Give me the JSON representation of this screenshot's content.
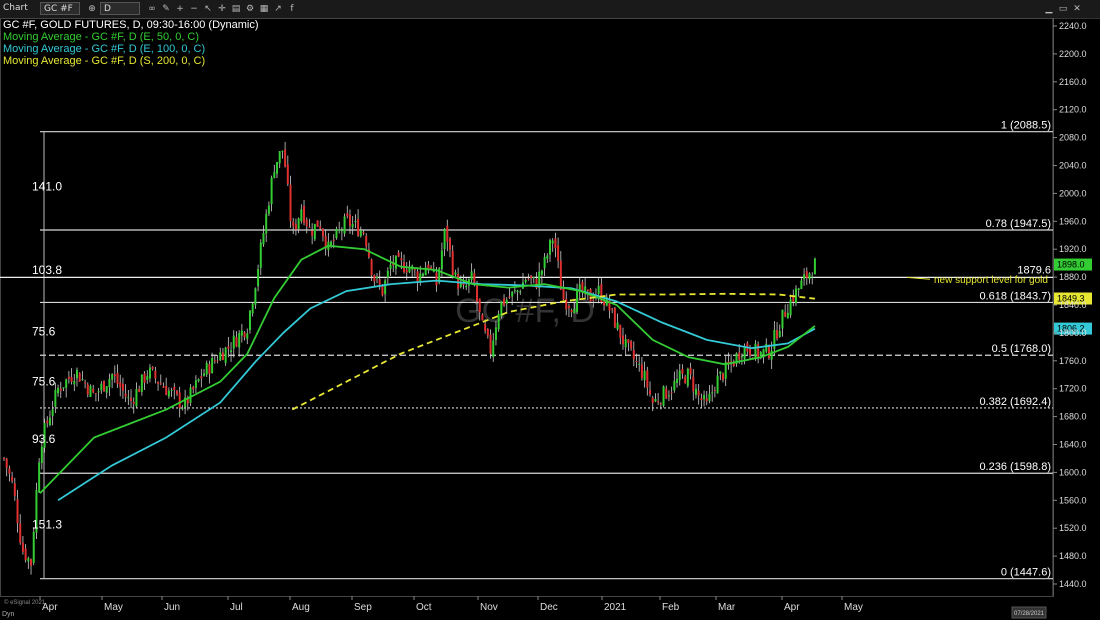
{
  "toolbar": {
    "window_label": "Chart",
    "symbol_field": "GC #F",
    "interval_field": "D"
  },
  "legend": {
    "title": "GC #F, GOLD FUTURES, D, 09:30-16:00 (Dynamic)",
    "ma50": "Moving Average - GC #F, D (E, 50, 0, C)",
    "ma100": "Moving Average - GC #F, D (E, 100, 0, C)",
    "ma200": "Moving Average - GC #F, D (S, 200, 0, C)"
  },
  "watermark": "GC #F, D",
  "footer": {
    "copyright": "© eSignal 2021",
    "corner_label": "Dyn",
    "date_box": "07/28/2021"
  },
  "colors": {
    "background": "#000000",
    "candle_up": "#33cc33",
    "candle_down": "#e03030",
    "ma50": "#33cc33",
    "ma100": "#33c9d6",
    "ma200": "#e6e633",
    "fib_line": "#d8d8d8",
    "annotation": "#e6e633",
    "title": "#ffffff"
  },
  "chart_data": {
    "type": "candlestick",
    "instrument": "GC #F, GOLD FUTURES",
    "timeframe": "D",
    "ylim": [
      1430,
      2260
    ],
    "y_ticks": [
      1440.0,
      1480.0,
      1520.0,
      1560.0,
      1600.0,
      1640.0,
      1680.0,
      1720.0,
      1760.0,
      1800.0,
      1840.0,
      1880.0,
      1920.0,
      1960.0,
      2000.0,
      2040.0,
      2080.0,
      2120.0,
      2160.0,
      2200.0,
      2240.0
    ],
    "x_labels": [
      "Apr",
      "May",
      "Jun",
      "Jul",
      "Aug",
      "Sep",
      "Oct",
      "Nov",
      "Dec",
      "2021",
      "Feb",
      "Mar",
      "Apr",
      "May"
    ],
    "fib_levels": [
      {
        "label": "1 (2088.5)",
        "price": 2088.5,
        "style": "solid"
      },
      {
        "label": "0.78 (1947.5)",
        "price": 1947.5,
        "style": "solid"
      },
      {
        "label": "0.618 (1843.7)",
        "price": 1843.7,
        "style": "solid"
      },
      {
        "label": "0.5 (1768.0)",
        "price": 1768.0,
        "style": "dashed"
      },
      {
        "label": "0.382 (1692.4)",
        "price": 1692.4,
        "style": "dotted"
      },
      {
        "label": "0.236 (1598.8)",
        "price": 1598.8,
        "style": "solid"
      },
      {
        "label": "0 (1447.6)",
        "price": 1447.6,
        "style": "solid"
      }
    ],
    "support_line": {
      "price": 1879.6,
      "label": "1879.6"
    },
    "annotation": "new support level for gold",
    "price_flags": [
      {
        "label": "1898.0",
        "price": 1898.0,
        "color": "#33cc33"
      },
      {
        "label": "1849.3",
        "price": 1849.3,
        "color": "#e6e633"
      },
      {
        "label": "1806.2",
        "price": 1806.2,
        "color": "#33c9d6"
      }
    ],
    "range_labels": [
      {
        "label": "141.0",
        "price": 2010
      },
      {
        "label": "103.8",
        "price": 1890
      },
      {
        "label": "75.6",
        "price": 1802
      },
      {
        "label": "75.6",
        "price": 1730
      },
      {
        "label": "93.6",
        "price": 1648
      },
      {
        "label": "151.3",
        "price": 1525
      }
    ],
    "close_path": [
      {
        "t": 0.0,
        "p": 1620
      },
      {
        "t": 0.01,
        "p": 1580
      },
      {
        "t": 0.02,
        "p": 1490
      },
      {
        "t": 0.03,
        "p": 1470
      },
      {
        "t": 0.04,
        "p": 1640
      },
      {
        "t": 0.06,
        "p": 1720
      },
      {
        "t": 0.08,
        "p": 1745
      },
      {
        "t": 0.1,
        "p": 1710
      },
      {
        "t": 0.12,
        "p": 1740
      },
      {
        "t": 0.14,
        "p": 1700
      },
      {
        "t": 0.16,
        "p": 1745
      },
      {
        "t": 0.18,
        "p": 1720
      },
      {
        "t": 0.2,
        "p": 1695
      },
      {
        "t": 0.22,
        "p": 1740
      },
      {
        "t": 0.24,
        "p": 1770
      },
      {
        "t": 0.25,
        "p": 1780
      },
      {
        "t": 0.27,
        "p": 1810
      },
      {
        "t": 0.28,
        "p": 1880
      },
      {
        "t": 0.29,
        "p": 1960
      },
      {
        "t": 0.3,
        "p": 2040
      },
      {
        "t": 0.31,
        "p": 2065
      },
      {
        "t": 0.32,
        "p": 1940
      },
      {
        "t": 0.33,
        "p": 1980
      },
      {
        "t": 0.34,
        "p": 1945
      },
      {
        "t": 0.35,
        "p": 1960
      },
      {
        "t": 0.36,
        "p": 1920
      },
      {
        "t": 0.38,
        "p": 1960
      },
      {
        "t": 0.4,
        "p": 1945
      },
      {
        "t": 0.41,
        "p": 1880
      },
      {
        "t": 0.42,
        "p": 1860
      },
      {
        "t": 0.43,
        "p": 1900
      },
      {
        "t": 0.45,
        "p": 1895
      },
      {
        "t": 0.46,
        "p": 1880
      },
      {
        "t": 0.47,
        "p": 1900
      },
      {
        "t": 0.48,
        "p": 1870
      },
      {
        "t": 0.49,
        "p": 1950
      },
      {
        "t": 0.5,
        "p": 1880
      },
      {
        "t": 0.51,
        "p": 1860
      },
      {
        "t": 0.52,
        "p": 1880
      },
      {
        "t": 0.53,
        "p": 1810
      },
      {
        "t": 0.54,
        "p": 1775
      },
      {
        "t": 0.55,
        "p": 1840
      },
      {
        "t": 0.57,
        "p": 1860
      },
      {
        "t": 0.58,
        "p": 1880
      },
      {
        "t": 0.59,
        "p": 1870
      },
      {
        "t": 0.6,
        "p": 1900
      },
      {
        "t": 0.61,
        "p": 1940
      },
      {
        "t": 0.62,
        "p": 1850
      },
      {
        "t": 0.63,
        "p": 1840
      },
      {
        "t": 0.64,
        "p": 1860
      },
      {
        "t": 0.65,
        "p": 1850
      },
      {
        "t": 0.66,
        "p": 1860
      },
      {
        "t": 0.67,
        "p": 1840
      },
      {
        "t": 0.68,
        "p": 1810
      },
      {
        "t": 0.69,
        "p": 1780
      },
      {
        "t": 0.7,
        "p": 1760
      },
      {
        "t": 0.71,
        "p": 1740
      },
      {
        "t": 0.72,
        "p": 1700
      },
      {
        "t": 0.73,
        "p": 1710
      },
      {
        "t": 0.74,
        "p": 1720
      },
      {
        "t": 0.75,
        "p": 1735
      },
      {
        "t": 0.76,
        "p": 1740
      },
      {
        "t": 0.77,
        "p": 1710
      },
      {
        "t": 0.78,
        "p": 1695
      },
      {
        "t": 0.79,
        "p": 1730
      },
      {
        "t": 0.8,
        "p": 1745
      },
      {
        "t": 0.81,
        "p": 1760
      },
      {
        "t": 0.82,
        "p": 1780
      },
      {
        "t": 0.83,
        "p": 1775
      },
      {
        "t": 0.84,
        "p": 1770
      },
      {
        "t": 0.85,
        "p": 1775
      },
      {
        "t": 0.86,
        "p": 1810
      },
      {
        "t": 0.87,
        "p": 1840
      },
      {
        "t": 0.88,
        "p": 1860
      },
      {
        "t": 0.89,
        "p": 1880
      },
      {
        "t": 0.9,
        "p": 1898
      }
    ],
    "ma50": [
      {
        "t": 0.04,
        "p": 1570
      },
      {
        "t": 0.1,
        "p": 1650
      },
      {
        "t": 0.18,
        "p": 1690
      },
      {
        "t": 0.24,
        "p": 1730
      },
      {
        "t": 0.27,
        "p": 1770
      },
      {
        "t": 0.3,
        "p": 1850
      },
      {
        "t": 0.33,
        "p": 1905
      },
      {
        "t": 0.36,
        "p": 1925
      },
      {
        "t": 0.4,
        "p": 1920
      },
      {
        "t": 0.44,
        "p": 1895
      },
      {
        "t": 0.48,
        "p": 1890
      },
      {
        "t": 0.52,
        "p": 1870
      },
      {
        "t": 0.56,
        "p": 1865
      },
      {
        "t": 0.6,
        "p": 1870
      },
      {
        "t": 0.64,
        "p": 1860
      },
      {
        "t": 0.68,
        "p": 1840
      },
      {
        "t": 0.72,
        "p": 1790
      },
      {
        "t": 0.76,
        "p": 1765
      },
      {
        "t": 0.8,
        "p": 1755
      },
      {
        "t": 0.84,
        "p": 1765
      },
      {
        "t": 0.87,
        "p": 1780
      },
      {
        "t": 0.9,
        "p": 1810
      }
    ],
    "ma100": [
      {
        "t": 0.06,
        "p": 1560
      },
      {
        "t": 0.12,
        "p": 1610
      },
      {
        "t": 0.18,
        "p": 1650
      },
      {
        "t": 0.24,
        "p": 1700
      },
      {
        "t": 0.28,
        "p": 1760
      },
      {
        "t": 0.31,
        "p": 1800
      },
      {
        "t": 0.34,
        "p": 1835
      },
      {
        "t": 0.38,
        "p": 1860
      },
      {
        "t": 0.43,
        "p": 1870
      },
      {
        "t": 0.48,
        "p": 1875
      },
      {
        "t": 0.53,
        "p": 1870
      },
      {
        "t": 0.58,
        "p": 1868
      },
      {
        "t": 0.63,
        "p": 1864
      },
      {
        "t": 0.68,
        "p": 1845
      },
      {
        "t": 0.73,
        "p": 1815
      },
      {
        "t": 0.78,
        "p": 1790
      },
      {
        "t": 0.83,
        "p": 1778
      },
      {
        "t": 0.87,
        "p": 1785
      },
      {
        "t": 0.9,
        "p": 1806
      }
    ],
    "ma200": [
      {
        "t": 0.32,
        "p": 1690
      },
      {
        "t": 0.38,
        "p": 1730
      },
      {
        "t": 0.44,
        "p": 1770
      },
      {
        "t": 0.5,
        "p": 1800
      },
      {
        "t": 0.56,
        "p": 1830
      },
      {
        "t": 0.62,
        "p": 1845
      },
      {
        "t": 0.68,
        "p": 1855
      },
      {
        "t": 0.74,
        "p": 1855
      },
      {
        "t": 0.8,
        "p": 1856
      },
      {
        "t": 0.86,
        "p": 1855
      },
      {
        "t": 0.9,
        "p": 1849
      }
    ]
  }
}
